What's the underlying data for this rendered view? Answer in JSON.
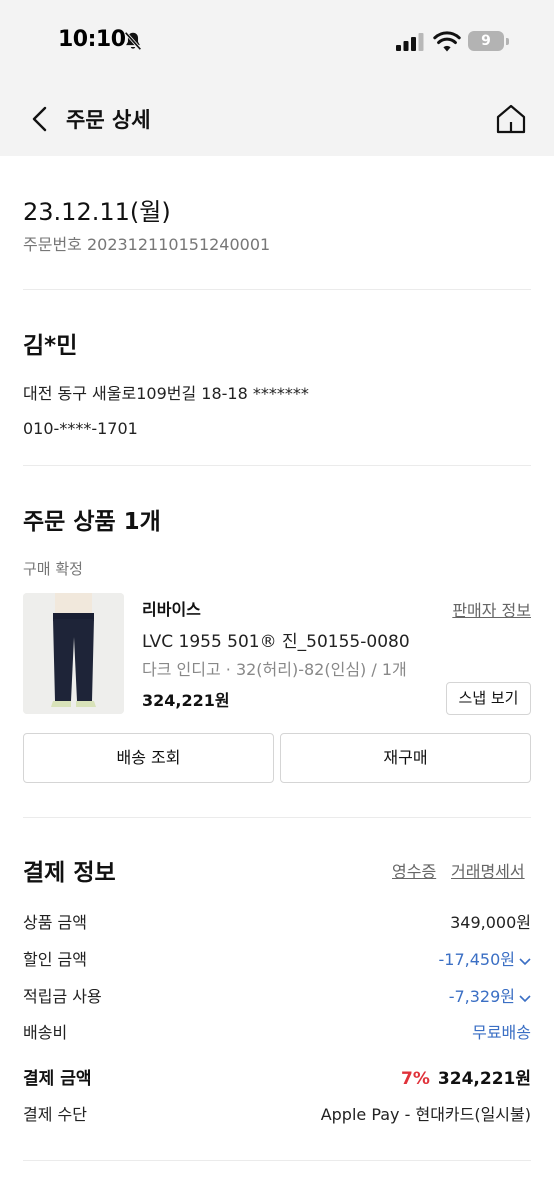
{
  "status_bar": {
    "time": "10:10",
    "battery": "9"
  },
  "nav": {
    "title": "주문 상세"
  },
  "order": {
    "date": "23.12.11(월)",
    "order_number": "주문번호 202312110151240001"
  },
  "recipient": {
    "name": "김*민",
    "address": "대전 동구 새울로109번길 18-18 *******",
    "phone": "010-****-1701"
  },
  "products": {
    "title": "주문 상품 1개",
    "status": "구매 확정",
    "items": [
      {
        "brand": "리바이스",
        "seller_info_label": "판매자 정보",
        "name": "LVC 1955 501® 진_50155-0080",
        "option": "다크 인디고 · 32(허리)-82(인심) / 1개",
        "price": "324,221원",
        "snap_label": "스냅 보기"
      }
    ],
    "track_label": "배송 조회",
    "reorder_label": "재구매"
  },
  "payment": {
    "title": "결제 정보",
    "receipt_label": "영수증",
    "statement_label": "거래명세서",
    "rows": [
      {
        "label": "상품 금액",
        "value": "349,000원"
      },
      {
        "label": "할인 금액",
        "value": "-17,450원"
      },
      {
        "label": "적립금 사용",
        "value": "-7,329원"
      },
      {
        "label": "배송비",
        "value": "무료배송"
      }
    ],
    "total": {
      "label": "결제 금액",
      "discount_rate": "7%",
      "value": "324,221원"
    },
    "method": {
      "label": "결제 수단",
      "value": "Apple Pay - 현대카드(일시불)"
    }
  },
  "colors": {
    "accent_blue": "#3b6fc4",
    "discount_red": "#e0323a",
    "header_bg": "#f3f3f3"
  },
  "icons": [
    "bell-slash-icon",
    "signal-icon",
    "wifi-icon",
    "battery-icon",
    "back-chevron-icon",
    "home-icon",
    "chevron-down-icon"
  ]
}
